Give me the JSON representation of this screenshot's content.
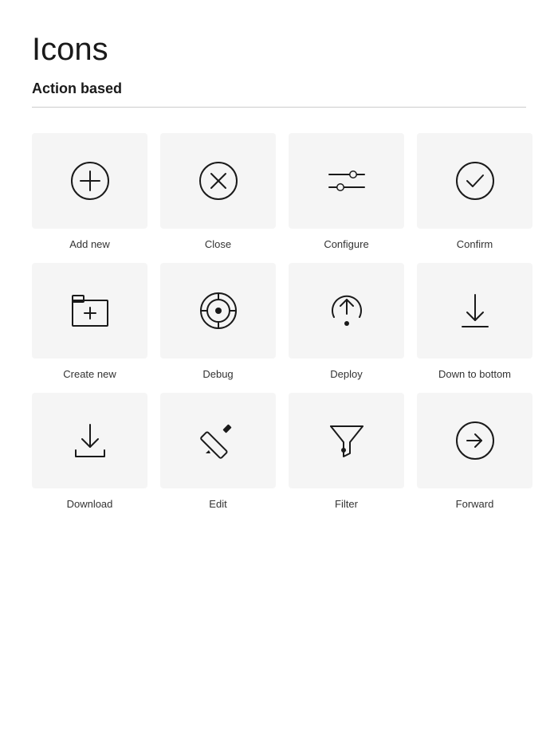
{
  "page": {
    "title": "Icons",
    "section": "Action based"
  },
  "icons": [
    {
      "name": "add-new-icon",
      "label": "Add new"
    },
    {
      "name": "close-icon",
      "label": "Close"
    },
    {
      "name": "configure-icon",
      "label": "Configure"
    },
    {
      "name": "confirm-icon",
      "label": "Confirm"
    },
    {
      "name": "create-new-icon",
      "label": "Create new"
    },
    {
      "name": "debug-icon",
      "label": "Debug"
    },
    {
      "name": "deploy-icon",
      "label": "Deploy"
    },
    {
      "name": "down-to-bottom-icon",
      "label": "Down to bottom"
    },
    {
      "name": "download-icon",
      "label": "Download"
    },
    {
      "name": "edit-icon",
      "label": "Edit"
    },
    {
      "name": "filter-icon",
      "label": "Filter"
    },
    {
      "name": "forward-icon",
      "label": "Forward"
    }
  ]
}
